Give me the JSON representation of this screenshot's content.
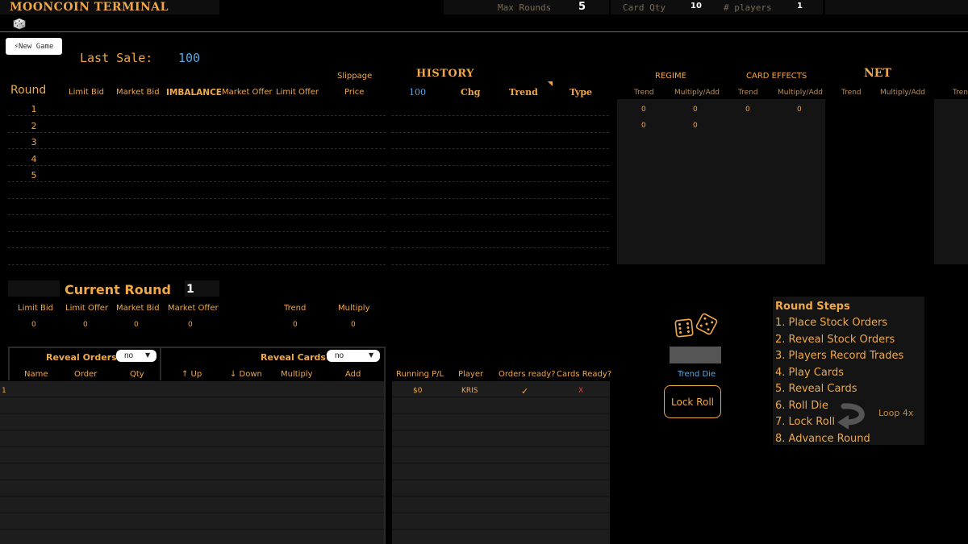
{
  "header": {
    "title": "MOONCOIN TERMINAL",
    "max_rounds_label": "Max Rounds",
    "max_rounds_value": "5",
    "card_qty_label": "Card Qty",
    "card_qty_value": "10",
    "players_label": "# players",
    "players_value": "1",
    "dice_icon": "dice-icon"
  },
  "toolbar": {
    "new_game_label": "⚡New Game",
    "last_sale_label": "Last Sale:",
    "last_sale_value": "100"
  },
  "history_table": {
    "round_header": "Round",
    "columns": [
      "Limit Bid",
      "Market Bid",
      "IMBALANCE",
      "Market Offer",
      "Limit Offer"
    ],
    "slippage_label": "Slippage",
    "price_label": "Price",
    "history_title": "HISTORY",
    "history_columns": [
      "100",
      "Chg",
      "Trend",
      "Type"
    ],
    "rounds": [
      "1",
      "2",
      "3",
      "4",
      "5"
    ]
  },
  "regime": {
    "regime_title": "REGIME",
    "card_effects_title": "CARD EFFECTS",
    "net_title": "NET",
    "sub_headers": [
      "Trend",
      "Multiply/Add",
      "Trend",
      "Multiply/Add",
      "Trend",
      "Multiply/Add",
      "Tren"
    ],
    "row1": [
      "0",
      "0",
      "0",
      "0"
    ],
    "row2": [
      "0",
      "0"
    ]
  },
  "current_round": {
    "label": "Current Round",
    "value": "1",
    "headers": [
      "Limit Bid",
      "Limit Offer",
      "Market Bid",
      "Market Offer",
      "Trend",
      "Multiply"
    ],
    "values": [
      "0",
      "0",
      "0",
      "0",
      "0",
      "0"
    ]
  },
  "orders_panel": {
    "reveal_orders_label": "Reveal Orders?",
    "reveal_orders_value": "no",
    "reveal_cards_label": "Reveal Cards?",
    "reveal_cards_value": "no",
    "columns": [
      "Name",
      "Order",
      "Qty",
      "↑ Up",
      "↓ Down",
      "Multiply",
      "Add"
    ],
    "first_row_index": "1"
  },
  "players_panel": {
    "columns": [
      "Running P/L",
      "Player",
      "Orders ready?",
      "Cards Ready?"
    ],
    "rows": [
      {
        "pl": "$0",
        "player": "KRIS",
        "orders_ready": "✓",
        "cards_ready": "X"
      }
    ]
  },
  "dice": {
    "trend_die_label": "Trend Die",
    "lock_roll_label": "Lock Roll"
  },
  "round_steps": {
    "title": "Round Steps",
    "steps": [
      "1. Place Stock Orders",
      "2. Reveal Stock Orders",
      "3. Players Record Trades",
      "4. Play Cards",
      "5. Reveal Cards",
      "6. Roll Die",
      "7. Lock Roll",
      "8. Advance Round"
    ],
    "loop_label": "Loop 4x"
  },
  "colors": {
    "accent": "#f0a848",
    "background": "#000000",
    "blue": "#5aa8e8",
    "red": "#e04040"
  }
}
